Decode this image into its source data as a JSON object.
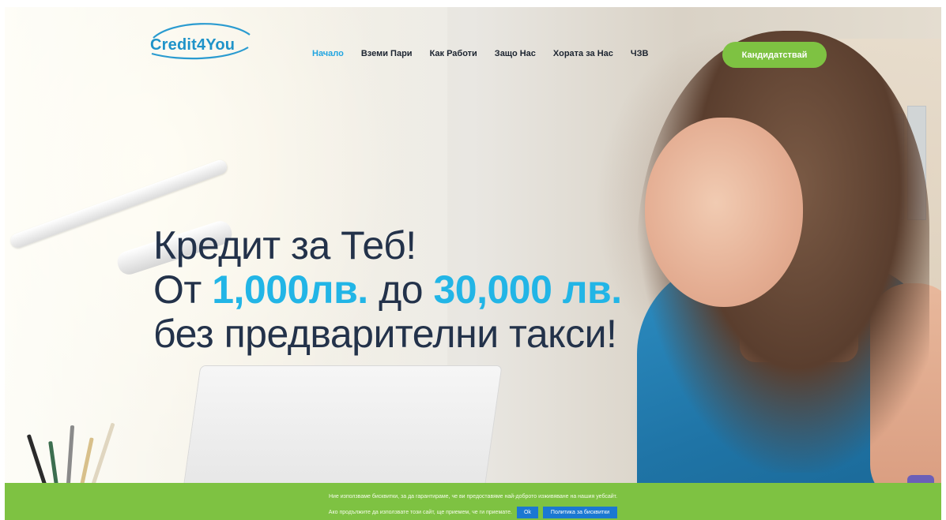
{
  "header": {
    "logo": {
      "text_main": "Credit",
      "text_accent": "4You"
    },
    "nav": [
      {
        "label": "Начало",
        "active": true
      },
      {
        "label": "Вземи Пари",
        "active": false
      },
      {
        "label": "Как Работи",
        "active": false
      },
      {
        "label": "Защо Нас",
        "active": false
      },
      {
        "label": "Хората за Нас",
        "active": false
      },
      {
        "label": "ЧЗВ",
        "active": false
      }
    ],
    "cta_label": "Кандидатствай"
  },
  "hero": {
    "line1": "Кредит за Теб!",
    "line2_prefix": "От ",
    "line2_amount_from": "1,000лв.",
    "line2_middle": " до ",
    "line2_amount_to": "30,000 лв.",
    "line3": "без предварителни такси!"
  },
  "cookie_bar": {
    "line1": "Ние използваме бисквитки, за да гарантираме, че ви предоставяме най-доброто изживяване на нашия уебсайт.",
    "line2": "Ако продължите да използвате този сайт, ще приемем, че ги приемате.",
    "ok_label": "Ok",
    "policy_label": "Политика за бисквитки"
  },
  "colors": {
    "brand_blue": "#22a5e0",
    "accent_green": "#7ec242",
    "hero_text": "#23324a",
    "cookie_button": "#1b78d2"
  }
}
